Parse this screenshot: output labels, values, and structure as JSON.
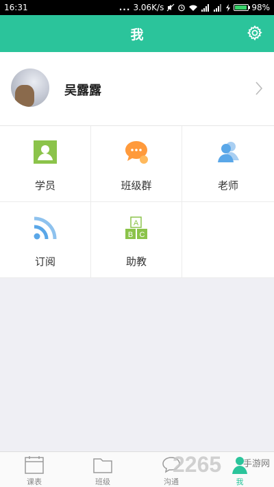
{
  "status_bar": {
    "time": "16:31",
    "dots": "...",
    "speed": "3.06K/s",
    "battery": "98%"
  },
  "header": {
    "title": "我",
    "settings_icon": "gear-icon"
  },
  "profile": {
    "name": "吴露露"
  },
  "grid": {
    "items": [
      {
        "label": "学员",
        "icon": "student-icon",
        "color": "#8bc34a"
      },
      {
        "label": "班级群",
        "icon": "chat-group-icon",
        "color": "#ff9a3c"
      },
      {
        "label": "老师",
        "icon": "teacher-icon",
        "color": "#5aa7e8"
      },
      {
        "label": "订阅",
        "icon": "rss-icon",
        "color": "#5aa7e8"
      },
      {
        "label": "助教",
        "icon": "abc-blocks-icon",
        "color": "#8bc34a"
      }
    ]
  },
  "tabbar": {
    "items": [
      {
        "label": "课表",
        "icon": "calendar-icon"
      },
      {
        "label": "班级",
        "icon": "folder-icon"
      },
      {
        "label": "沟通",
        "icon": "chat-icon"
      },
      {
        "label": "我",
        "icon": "person-icon",
        "active": true
      }
    ]
  },
  "watermark": {
    "number": "2265",
    "text": "手游网"
  },
  "colors": {
    "accent": "#2bc49b",
    "background": "#efeff4"
  }
}
